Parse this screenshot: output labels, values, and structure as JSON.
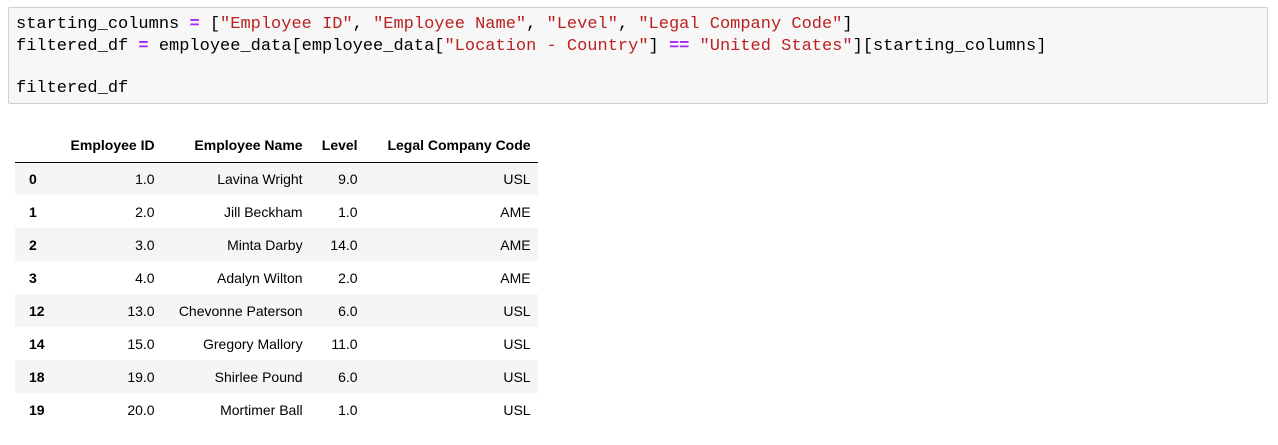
{
  "code_cell": {
    "line1": {
      "var": "starting_columns",
      "op": "=",
      "open": " [",
      "s1": "\"Employee ID\"",
      "sep1": ", ",
      "s2": "\"Employee Name\"",
      "sep2": ", ",
      "s3": "\"Level\"",
      "sep3": ", ",
      "s4": "\"Legal Company Code\"",
      "close": "]"
    },
    "line2": {
      "var": "filtered_df",
      "op": "=",
      "pre": " employee_data[employee_data[",
      "s1": "\"Location - Country\"",
      "mid": "] ",
      "op2": "==",
      "s2": "\"United States\"",
      "post": "][starting_columns]"
    },
    "line3": "filtered_df"
  },
  "dataframe": {
    "columns": [
      "",
      "Employee ID",
      "Employee Name",
      "Level",
      "Legal Company Code"
    ],
    "rows": [
      {
        "index": "0",
        "employee_id": "1.0",
        "employee_name": "Lavina Wright",
        "level": "9.0",
        "legal_company_code": "USL"
      },
      {
        "index": "1",
        "employee_id": "2.0",
        "employee_name": "Jill Beckham",
        "level": "1.0",
        "legal_company_code": "AME"
      },
      {
        "index": "2",
        "employee_id": "3.0",
        "employee_name": "Minta Darby",
        "level": "14.0",
        "legal_company_code": "AME"
      },
      {
        "index": "3",
        "employee_id": "4.0",
        "employee_name": "Adalyn Wilton",
        "level": "2.0",
        "legal_company_code": "AME"
      },
      {
        "index": "12",
        "employee_id": "13.0",
        "employee_name": "Chevonne Paterson",
        "level": "6.0",
        "legal_company_code": "USL"
      },
      {
        "index": "14",
        "employee_id": "15.0",
        "employee_name": "Gregory Mallory",
        "level": "11.0",
        "legal_company_code": "USL"
      },
      {
        "index": "18",
        "employee_id": "19.0",
        "employee_name": "Shirlee Pound",
        "level": "6.0",
        "legal_company_code": "USL"
      },
      {
        "index": "19",
        "employee_id": "20.0",
        "employee_name": "Mortimer Ball",
        "level": "1.0",
        "legal_company_code": "USL"
      }
    ]
  }
}
